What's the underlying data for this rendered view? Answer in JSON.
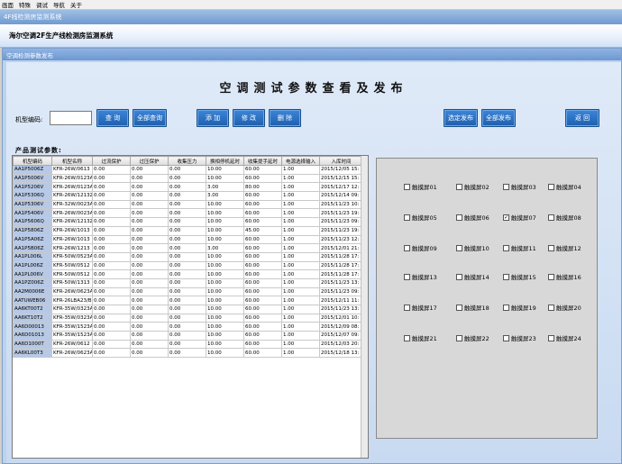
{
  "menu": [
    "画面",
    "特殊",
    "调试",
    "导航",
    "关于"
  ],
  "window_title": "4F线检测房监测系统",
  "app_header": "海尔空调2F生产线检测房监测系统",
  "panel_title": "空调检测参数发布",
  "page_title": "空调测试参数查看及发布",
  "search": {
    "label": "机型编码:",
    "value": ""
  },
  "buttons": {
    "query": "查 询",
    "query_all": "全部查询",
    "add": "添 加",
    "edit": "修 改",
    "delete": "删 除",
    "publish_selected": "选定发布",
    "publish_all": "全部发布",
    "back": "返 回"
  },
  "section_label": "产品测试参数:",
  "table": {
    "headers": [
      "机型编码",
      "机型名称",
      "过流保护",
      "过压保护",
      "收集压力",
      "换相停机延时",
      "收集提手延时",
      "电源选择输入",
      "入库时间"
    ],
    "rows": [
      [
        "AA1P5006Z",
        "KFR-26W/0613",
        "0.00",
        "0.00",
        "0.00",
        "10.00",
        "60.00",
        "1.00",
        "2015/12/05 15:"
      ],
      [
        "AA1P5006V",
        "KFR-26W/0123A",
        "0.00",
        "0.00",
        "0.00",
        "10.00",
        "60.00",
        "1.00",
        "2015/12/15 15:"
      ],
      [
        "AA1P5206V",
        "KFR-26W/0123A",
        "0.00",
        "0.00",
        "0.00",
        "3.00",
        "80.00",
        "1.00",
        "2015/12/17 12:"
      ],
      [
        "AA1P5306Q",
        "KFR-26W/1213Z",
        "0.00",
        "0.00",
        "0.00",
        "3.00",
        "60.00",
        "1.00",
        "2015/12/14 09:"
      ],
      [
        "AA1P5306V",
        "KFR-32W/0023A",
        "0.00",
        "0.00",
        "0.00",
        "10.00",
        "60.00",
        "1.00",
        "2015/11/23 10:"
      ],
      [
        "AA1P5406V",
        "KFR-26W/0023A",
        "0.00",
        "0.00",
        "0.00",
        "10.00",
        "60.00",
        "1.00",
        "2015/11/23 19:"
      ],
      [
        "AA1P5606Q",
        "KFR-26W/1213Z",
        "0.00",
        "0.00",
        "0.00",
        "10.00",
        "60.00",
        "1.00",
        "2015/11/23 09:"
      ],
      [
        "AA1P5806Z",
        "KFR-26W/1013",
        "0.00",
        "0.00",
        "0.00",
        "10.00",
        "45.00",
        "1.00",
        "2015/11/23 19:"
      ],
      [
        "AA1P5A06Z",
        "KFR-26W/1013",
        "0.00",
        "0.00",
        "0.00",
        "10.00",
        "60.00",
        "1.00",
        "2015/11/23 12:"
      ],
      [
        "AA1P5B06Z",
        "KFR-26W/1213",
        "0.00",
        "0.00",
        "0.00",
        "3.00",
        "60.00",
        "1.00",
        "2015/12/01 21:"
      ],
      [
        "AA1PL006L",
        "KFR-50W/0523A",
        "0.00",
        "0.00",
        "0.00",
        "10.00",
        "60.00",
        "1.00",
        "2015/11/28 17:"
      ],
      [
        "AA1PL006Z",
        "KFR-50W/0512",
        "0.00",
        "0.00",
        "0.00",
        "10.00",
        "60.00",
        "1.00",
        "2015/11/28 17:"
      ],
      [
        "AA1PL006V",
        "KFR-50W/0512",
        "0.00",
        "0.00",
        "0.00",
        "10.00",
        "60.00",
        "1.00",
        "2015/11/28 17:"
      ],
      [
        "AA1PZ006Z",
        "KFR-50W/1313",
        "0.00",
        "0.00",
        "0.00",
        "10.00",
        "60.00",
        "1.00",
        "2015/11/23 13:"
      ],
      [
        "AA2M0006E",
        "KFR-26W/0623A",
        "0.00",
        "0.00",
        "0.00",
        "10.00",
        "60.00",
        "1.00",
        "2015/11/23 09:"
      ],
      [
        "AATUWEB06",
        "KFR-26LBA23/B2",
        "0.00",
        "0.00",
        "0.00",
        "10.00",
        "60.00",
        "1.00",
        "2015/12/11 11:"
      ],
      [
        "AA6KT00T2",
        "KFR-35W/0323A",
        "0.00",
        "0.00",
        "0.00",
        "10.00",
        "60.00",
        "1.00",
        "2015/11/23 13:"
      ],
      [
        "AA6KT10T2",
        "KFR-35W/0323A",
        "0.00",
        "0.00",
        "0.00",
        "10.00",
        "60.00",
        "1.00",
        "2015/12/01 10:"
      ],
      [
        "AA6D00013",
        "KFR-35W/1523A",
        "0.00",
        "0.00",
        "0.00",
        "10.00",
        "60.00",
        "1.00",
        "2015/12/09 08:"
      ],
      [
        "AA6D01013",
        "KFR-35W/1523A",
        "0.00",
        "0.00",
        "0.00",
        "10.00",
        "60.00",
        "1.00",
        "2015/12/07 09:"
      ],
      [
        "AA6D1000T",
        "KFR-26W/0612",
        "0.00",
        "0.00",
        "0.00",
        "10.00",
        "60.00",
        "1.00",
        "2015/12/03 20:"
      ],
      [
        "AA6KL00T3",
        "KFR-26W/0623A",
        "0.00",
        "0.00",
        "0.00",
        "10.00",
        "60.00",
        "1.00",
        "2015/12/18 13:"
      ]
    ]
  },
  "checkboxes": [
    {
      "label": "触摸屏01",
      "checked": false
    },
    {
      "label": "触摸屏02",
      "checked": false
    },
    {
      "label": "触摸屏03",
      "checked": false
    },
    {
      "label": "触摸屏04",
      "checked": false
    },
    {
      "label": "触摸屏05",
      "checked": false
    },
    {
      "label": "触摸屏06",
      "checked": false
    },
    {
      "label": "触摸屏07",
      "checked": true
    },
    {
      "label": "触摸屏08",
      "checked": false
    },
    {
      "label": "触摸屏09",
      "checked": false
    },
    {
      "label": "触摸屏10",
      "checked": false
    },
    {
      "label": "触摸屏11",
      "checked": false
    },
    {
      "label": "触摸屏12",
      "checked": false
    },
    {
      "label": "触摸屏13",
      "checked": false
    },
    {
      "label": "触摸屏14",
      "checked": false
    },
    {
      "label": "触摸屏15",
      "checked": false
    },
    {
      "label": "触摸屏16",
      "checked": false
    },
    {
      "label": "触摸屏17",
      "checked": false
    },
    {
      "label": "触摸屏18",
      "checked": false
    },
    {
      "label": "触摸屏19",
      "checked": false
    },
    {
      "label": "触摸屏20",
      "checked": false
    },
    {
      "label": "触摸屏21",
      "checked": false
    },
    {
      "label": "触摸屏22",
      "checked": false
    },
    {
      "label": "触摸屏23",
      "checked": false
    },
    {
      "label": "触摸屏24",
      "checked": false
    }
  ]
}
